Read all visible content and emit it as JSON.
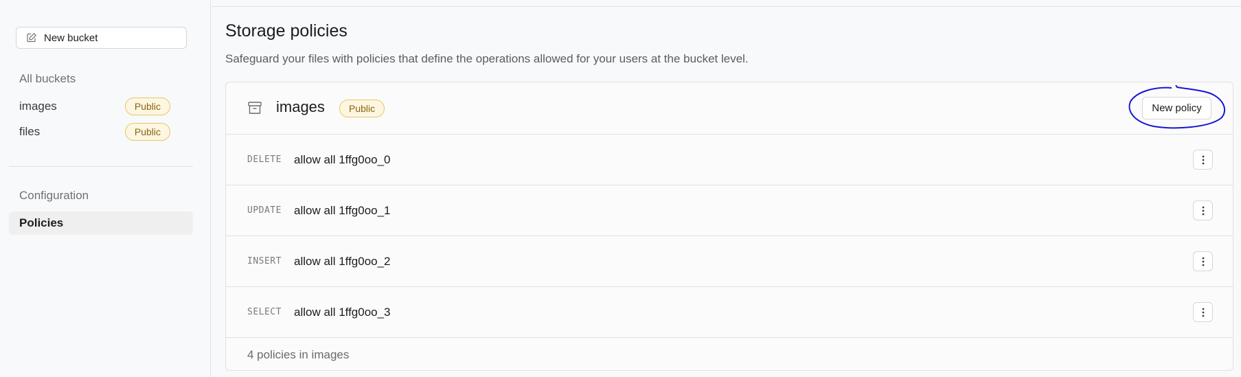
{
  "sidebar": {
    "new_bucket_label": "New bucket",
    "all_buckets_title": "All buckets",
    "buckets": [
      {
        "name": "images",
        "badge": "Public"
      },
      {
        "name": "files",
        "badge": "Public"
      }
    ],
    "configuration_title": "Configuration",
    "policies_label": "Policies"
  },
  "main": {
    "title": "Storage policies",
    "subtitle": "Safeguard your files with policies that define the operations allowed for your users at the bucket level."
  },
  "card": {
    "bucket_name": "images",
    "badge": "Public",
    "new_policy_label": "New policy",
    "policies": [
      {
        "operation": "DELETE",
        "name": "allow all 1ffg0oo_0"
      },
      {
        "operation": "UPDATE",
        "name": "allow all 1ffg0oo_1"
      },
      {
        "operation": "INSERT",
        "name": "allow all 1ffg0oo_2"
      },
      {
        "operation": "SELECT",
        "name": "allow all 1ffg0oo_3"
      }
    ],
    "footer": "4 policies in images"
  },
  "colors": {
    "badge_text": "#8a6412",
    "badge_border": "#e8c56a",
    "annotation": "#1515d6"
  }
}
